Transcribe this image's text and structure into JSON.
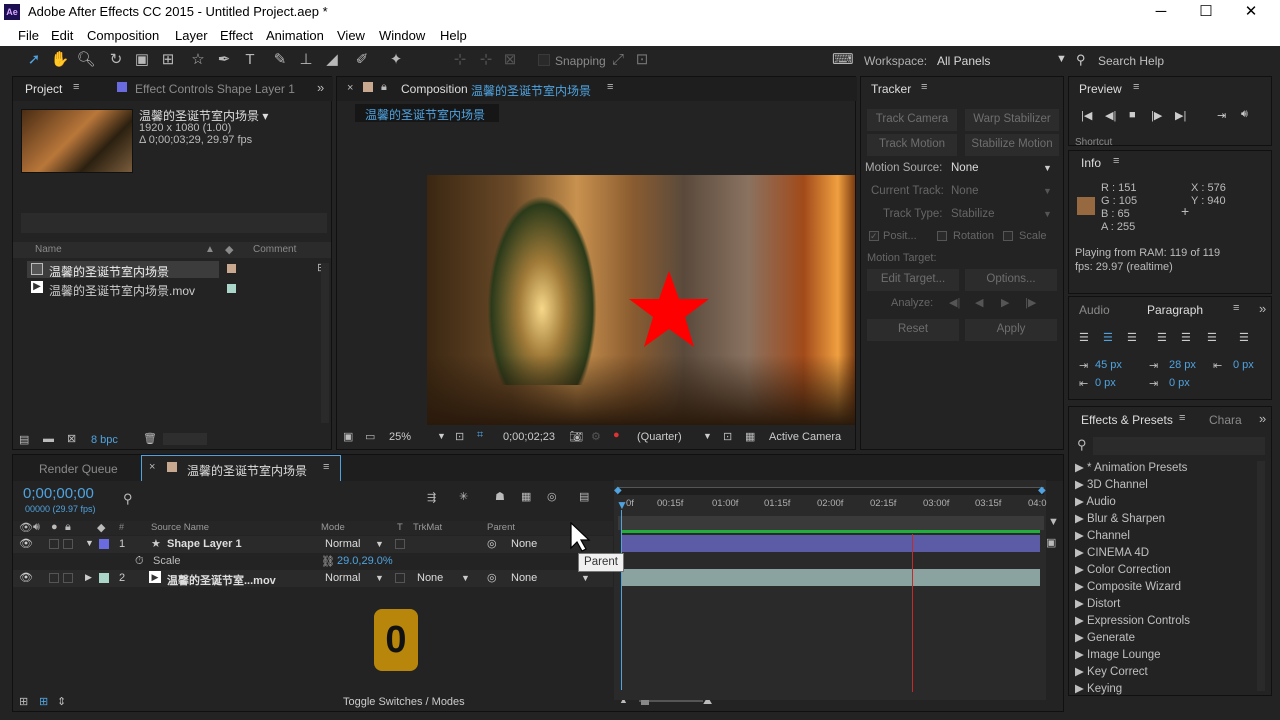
{
  "title": "Adobe After Effects CC 2015 - Untitled Project.aep *",
  "app_icon": "Ae",
  "window_controls": {
    "minimize": "─",
    "maximize": "☐",
    "close": "✕"
  },
  "menu": [
    "File",
    "Edit",
    "Composition",
    "Layer",
    "Effect",
    "Animation",
    "View",
    "Window",
    "Help"
  ],
  "toolbar": {
    "snapping": "Snapping",
    "workspace_label": "Workspace:",
    "workspace_value": "All Panels",
    "search_help": "Search Help"
  },
  "project": {
    "tab": "Project",
    "effect_controls_tab": "Effect Controls Shape Layer 1",
    "comp_name": "温馨的圣诞节室内场景 ▾",
    "comp_res": "1920 x 1080 (1.00)",
    "comp_dur": "Δ 0;00;03;29, 29.97 fps",
    "search_placeholder": "",
    "col_name": "Name",
    "col_comment": "Comment",
    "items": [
      {
        "name": "温馨的圣诞节室内场景",
        "color": "#c8a98f"
      },
      {
        "name": "温馨的圣诞节室内场景.mov",
        "color": "#a9d6c9"
      }
    ],
    "bpc": "8 bpc"
  },
  "composition": {
    "tab_label": "Composition",
    "tab_name": "温馨的圣诞节室内场景",
    "breadcrumb": "温馨的圣诞节室内场景",
    "zoom": "25%",
    "timecode": "0;00;02;23",
    "resolution": "(Quarter)",
    "camera": "Active Camera"
  },
  "tracker": {
    "title": "Tracker",
    "track_camera": "Track Camera",
    "warp_stabilizer": "Warp Stabilizer",
    "track_motion": "Track Motion",
    "stabilize_motion": "Stabilize Motion",
    "motion_source_label": "Motion Source:",
    "motion_source": "None",
    "current_track_label": "Current Track:",
    "current_track": "None",
    "track_type_label": "Track Type:",
    "track_type": "Stabilize",
    "position": "Posit...",
    "rotation": "Rotation",
    "scale": "Scale",
    "motion_target_label": "Motion Target:",
    "edit_target": "Edit Target...",
    "options": "Options...",
    "analyze_label": "Analyze:",
    "reset": "Reset",
    "apply": "Apply"
  },
  "preview": {
    "title": "Preview",
    "shortcut": "Shortcut"
  },
  "info": {
    "title": "Info",
    "r": "R : 151",
    "g": "G : 105",
    "b": "B : 65",
    "a": "A : 255",
    "x": "X : 576",
    "y": "Y : 940",
    "swatch": "#976941",
    "playing": "Playing from RAM: 119 of 119",
    "fps": "fps: 29.97 (realtime)"
  },
  "paragraph": {
    "audio_tab": "Audio",
    "title": "Paragraph",
    "indent_left": "45 px",
    "indent_first": "28 px",
    "indent_right": "0 px",
    "space_before": "0 px",
    "space_after": "0 px"
  },
  "effects": {
    "title": "Effects & Presets",
    "char_tab": "Chara",
    "search_placeholder": "",
    "items": [
      "▶ * Animation Presets",
      "▶ 3D Channel",
      "▶ Audio",
      "▶ Blur & Sharpen",
      "▶ Channel",
      "▶ CINEMA 4D",
      "▶ Color Correction",
      "▶ Composite Wizard",
      "▶ Distort",
      "▶ Expression Controls",
      "▶ Generate",
      "▶ Image Lounge",
      "▶ Key Correct",
      "▶ Keying"
    ]
  },
  "timeline": {
    "render_queue": "Render Queue",
    "comp_tab": "温馨的圣诞节室内场景",
    "timecode": "0;00;00;00",
    "fps_sub": "00000 (29.97 fps)",
    "col_source": "Source Name",
    "col_mode": "Mode",
    "col_t": "T",
    "col_trkmat": "TrkMat",
    "col_parent": "Parent",
    "layers": [
      {
        "num": "1",
        "name": "Shape Layer 1",
        "mode": "Normal",
        "parent": "None",
        "color": "#6b6be0"
      },
      {
        "num": "2",
        "name": "温馨的圣诞节室...mov",
        "mode": "Normal",
        "trkmat": "None",
        "parent": "None",
        "color": "#a9d6c9"
      }
    ],
    "scale_label": "Scale",
    "scale_value": "29.0,29.0%",
    "tooltip": "Parent",
    "ruler": [
      "0f",
      "00:15f",
      "01:00f",
      "01:15f",
      "02:00f",
      "02:15f",
      "03:00f",
      "03:15f",
      "04:0"
    ],
    "toggle": "Toggle Switches / Modes",
    "counter": "0"
  }
}
